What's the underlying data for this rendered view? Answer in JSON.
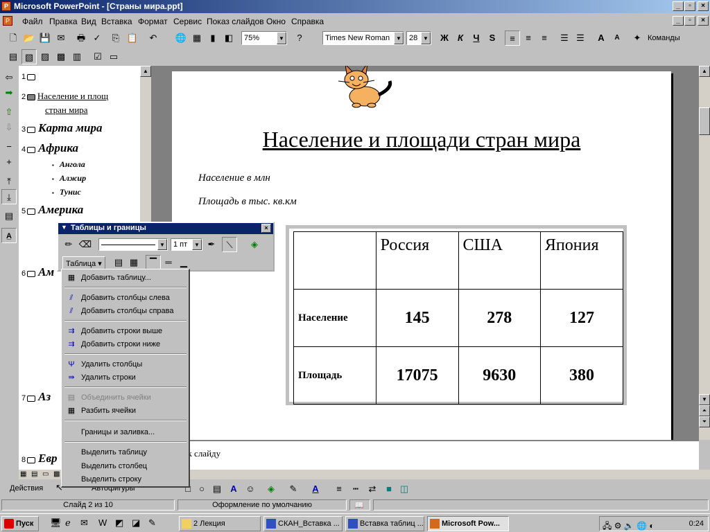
{
  "window": {
    "title": "Microsoft PowerPoint - [Страны мира.ppt]",
    "app_icon": "powerpoint-icon"
  },
  "menu": [
    "Файл",
    "Правка",
    "Вид",
    "Вставка",
    "Формат",
    "Сервис",
    "Показ слайдов",
    "Окно",
    "Справка"
  ],
  "toolbar": {
    "zoom": "75%",
    "font": "Times New Roman",
    "size": "28",
    "bold": "Ж",
    "italic": "К",
    "underline": "Ч",
    "shadow": "S",
    "commands": "Команды"
  },
  "outline": {
    "s1": "1",
    "s2num": "2",
    "s2a": "Население и площ",
    "s2b": "стран мира",
    "s3num": "3",
    "s3": "Карта мира",
    "s4num": "4",
    "s4": "Африка",
    "s4b": [
      "Ангола",
      "Алжир",
      "Тунис"
    ],
    "s5num": "5",
    "s5": "Америка",
    "s6num": "6",
    "s6": "Ам",
    "s7num": "7",
    "s7": "Аз",
    "s8num": "8",
    "s8": "Евр"
  },
  "slide": {
    "title": "Население и площади стран мира",
    "line1": "Население в млн",
    "line2": "Площадь в тыс. кв.км",
    "table": {
      "headers": [
        "",
        "Россия",
        "США",
        "Япония"
      ],
      "rows": [
        [
          "Население",
          "145",
          "278",
          "127"
        ],
        [
          "Площадь",
          "17075",
          "9630",
          "380"
        ]
      ]
    }
  },
  "notes": {
    "text": "Заметки к слайду"
  },
  "tables_toolbar": {
    "title": "Таблицы и границы",
    "weight": "1 пт",
    "table_btn": "Таблица"
  },
  "table_menu": {
    "items": [
      "Добавить таблицу...",
      "Добавить столбцы слева",
      "Добавить столбцы справа",
      "Добавить строки выше",
      "Добавить строки ниже",
      "Удалить столбцы",
      "Удалить строки",
      "Объединить ячейки",
      "Разбить ячейки",
      "Границы и заливка...",
      "Выделить таблицу",
      "Выделить столбец",
      "Выделить строку"
    ]
  },
  "drawbar": {
    "actions": "Действия",
    "autoshapes": "Автофигуры"
  },
  "status": {
    "slide": "Слайд 2 из 10",
    "design": "Оформление по умолчанию"
  },
  "taskbar": {
    "start": "Пуск",
    "tasks": [
      "2 Лекция",
      "СКАН_Вставка ...",
      "Вставка таблиц ...",
      "Microsoft Pow..."
    ],
    "clock": "0:24"
  }
}
